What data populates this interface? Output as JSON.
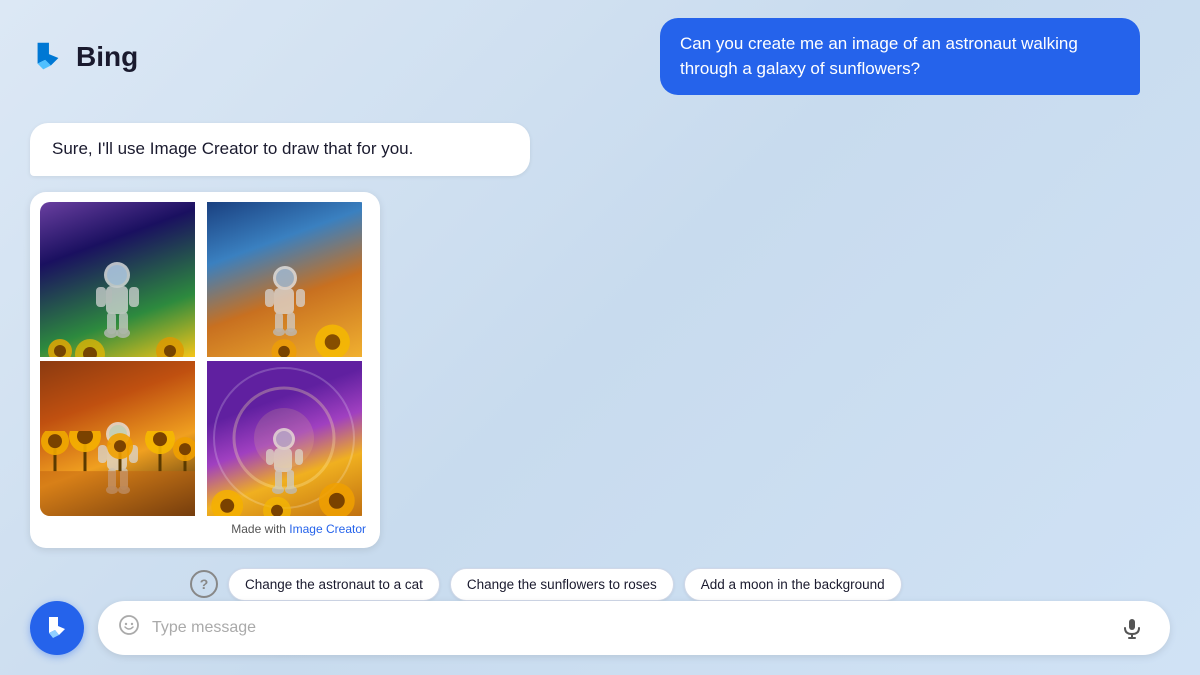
{
  "header": {
    "logo_text": "Bing"
  },
  "chat": {
    "user_message": "Can you create me an image of an astronaut walking through a galaxy of sunflowers?",
    "bot_message": "Sure, I'll use Image Creator to draw that for you.",
    "image_credit_prefix": "Made with ",
    "image_credit_link": "Image Creator"
  },
  "suggestions": {
    "help_icon": "?",
    "chips": [
      "Change the astronaut to a cat",
      "Change the sunflowers to roses",
      "Add a moon in the background"
    ]
  },
  "input": {
    "placeholder": "Type message"
  }
}
